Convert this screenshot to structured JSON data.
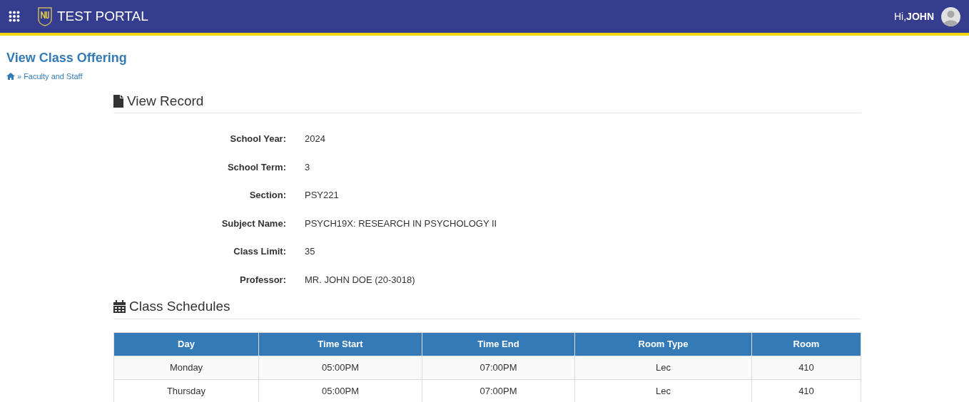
{
  "header": {
    "title": "TEST PORTAL",
    "greeting": "Hi,**JOHN**"
  },
  "page": {
    "title": "View Class Offering",
    "breadcrumb_separator": "»",
    "breadcrumb": "Faculty and Staff"
  },
  "record": {
    "heading": "View Record",
    "fields": [
      {
        "label": "School Year:",
        "value": "2024"
      },
      {
        "label": "School Term:",
        "value": "3"
      },
      {
        "label": "Section:",
        "value": "PSY221"
      },
      {
        "label": "Subject Name:",
        "value": "PSYCH19X: RESEARCH IN PSYCHOLOGY II"
      },
      {
        "label": "Class Limit:",
        "value": "35"
      },
      {
        "label": "Professor:",
        "value": "MR. JOHN DOE (20-3018)"
      }
    ]
  },
  "schedules": {
    "heading": "Class Schedules",
    "columns": [
      "Day",
      "Time Start",
      "Time End",
      "Room Type",
      "Room"
    ],
    "rows": [
      [
        "Monday",
        "05:00PM",
        "07:00PM",
        "Lec",
        "410"
      ],
      [
        "Thursday",
        "05:00PM",
        "07:00PM",
        "Lec",
        "410"
      ]
    ]
  }
}
